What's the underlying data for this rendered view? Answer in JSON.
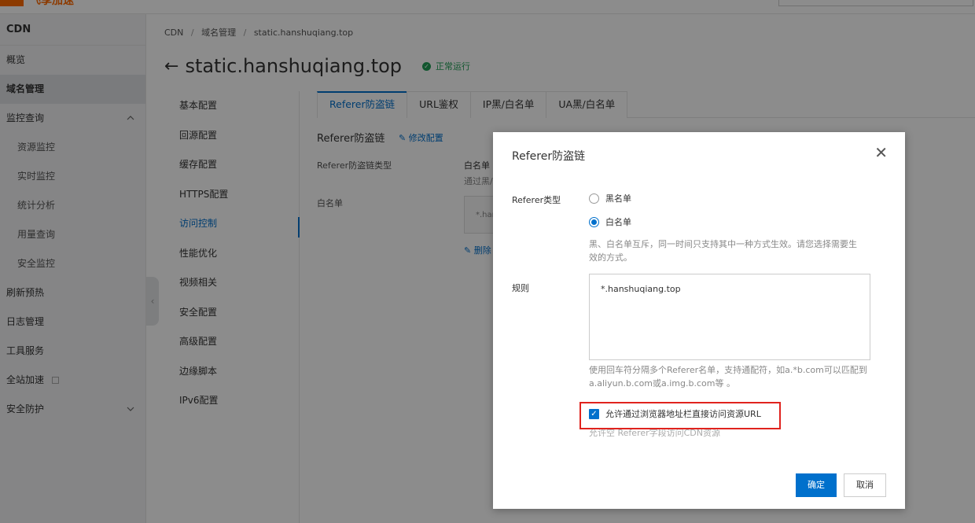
{
  "topbar": {
    "logo_text": "飞享加速"
  },
  "sidebar": {
    "title": "CDN",
    "items": [
      {
        "label": "概览"
      },
      {
        "label": "域名管理"
      },
      {
        "label": "监控查询"
      },
      {
        "label": "资源监控"
      },
      {
        "label": "实时监控"
      },
      {
        "label": "统计分析"
      },
      {
        "label": "用量查询"
      },
      {
        "label": "安全监控"
      },
      {
        "label": "刷新预热"
      },
      {
        "label": "日志管理"
      },
      {
        "label": "工具服务"
      },
      {
        "label": "全站加速"
      },
      {
        "label": "安全防护"
      }
    ],
    "collapse_glyph": "‹"
  },
  "breadcrumb": {
    "items": [
      "CDN",
      "域名管理",
      "static.hanshuqiang.top"
    ],
    "separator": "/"
  },
  "page": {
    "back_glyph": "←",
    "title": "static.hanshuqiang.top",
    "status_text": "正常运行",
    "status_color": "#1f9d55"
  },
  "subnav": {
    "items": [
      {
        "label": "基本配置"
      },
      {
        "label": "回源配置"
      },
      {
        "label": "缓存配置"
      },
      {
        "label": "HTTPS配置"
      },
      {
        "label": "访问控制"
      },
      {
        "label": "性能优化"
      },
      {
        "label": "视频相关"
      },
      {
        "label": "安全配置"
      },
      {
        "label": "高级配置"
      },
      {
        "label": "边缘脚本"
      },
      {
        "label": "IPv6配置"
      }
    ],
    "active_index": 4
  },
  "tabs": {
    "items": [
      {
        "label": "Referer防盗链"
      },
      {
        "label": "URL鉴权"
      },
      {
        "label": "IP黑/白名单"
      },
      {
        "label": "UA黑/白名单"
      }
    ],
    "active_index": 0
  },
  "content": {
    "section_title": "Referer防盗链",
    "edit_label": "修改配置",
    "type_label": "Referer防盗链类型",
    "type_value": "白名单",
    "type_note": "通过黑/",
    "list_label": "白名单",
    "list_value": "*.han",
    "delete_label": "删除"
  },
  "dialog": {
    "title": "Referer防盗链",
    "close_glyph": "✕",
    "type_label": "Referer类型",
    "options": [
      {
        "label": "黑名单",
        "selected": false
      },
      {
        "label": "白名单",
        "selected": true
      }
    ],
    "type_hint_1": "黑、白名单互斥，同一时间只支持其中一种方式生效。请您选择需要生",
    "type_hint_2": "效的方式。",
    "rule_label": "规则",
    "rule_value": "*.hanshuqiang.top",
    "rule_hint_1": "使用回车符分隔多个Referer名单，支持通配符，如a.*b.com可以匹配到",
    "rule_hint_2": "a.aliyun.b.com或a.img.b.com等 。",
    "checkbox_label": "允许通过浏览器地址栏直接访问资源URL",
    "checkbox_checked": true,
    "checkbox_hint": "允许空 Referer字段访问CDN资源",
    "ok_label": "确定",
    "cancel_label": "取消",
    "highlight_color": "#e0231e",
    "accent_color": "#0070cc"
  }
}
